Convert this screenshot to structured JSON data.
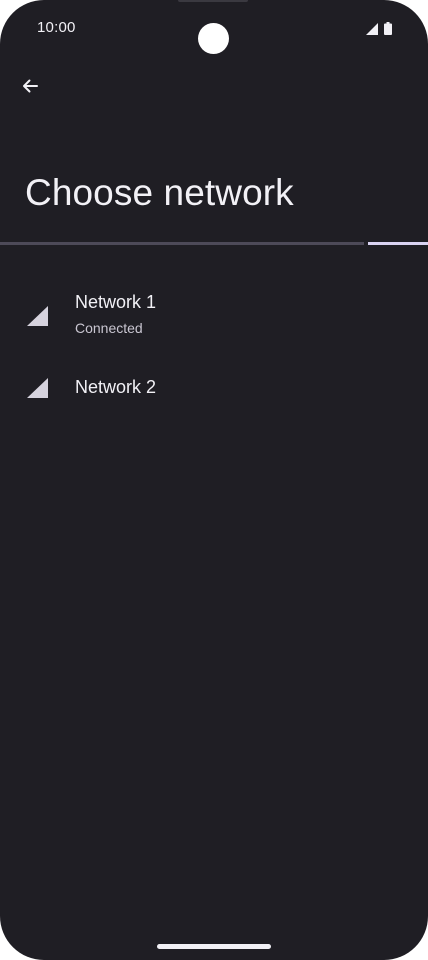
{
  "status_bar": {
    "time": "10:00",
    "icons": [
      "cell-signal-icon",
      "battery-icon"
    ]
  },
  "header": {
    "back_icon": "arrow-left-icon",
    "title": "Choose network"
  },
  "progress": {
    "indicator_color": "#d9d3f2",
    "track_color": "#4d4a58"
  },
  "networks": [
    {
      "name": "Network 1",
      "status": "Connected",
      "icon": "cell-signal-icon"
    },
    {
      "name": "Network 2",
      "icon": "cell-signal-icon"
    }
  ],
  "colors": {
    "background": "#1f1e24",
    "text_primary": "#f2f1f6",
    "text_secondary": "#c9c6d1",
    "icon": "#d6d3de"
  }
}
